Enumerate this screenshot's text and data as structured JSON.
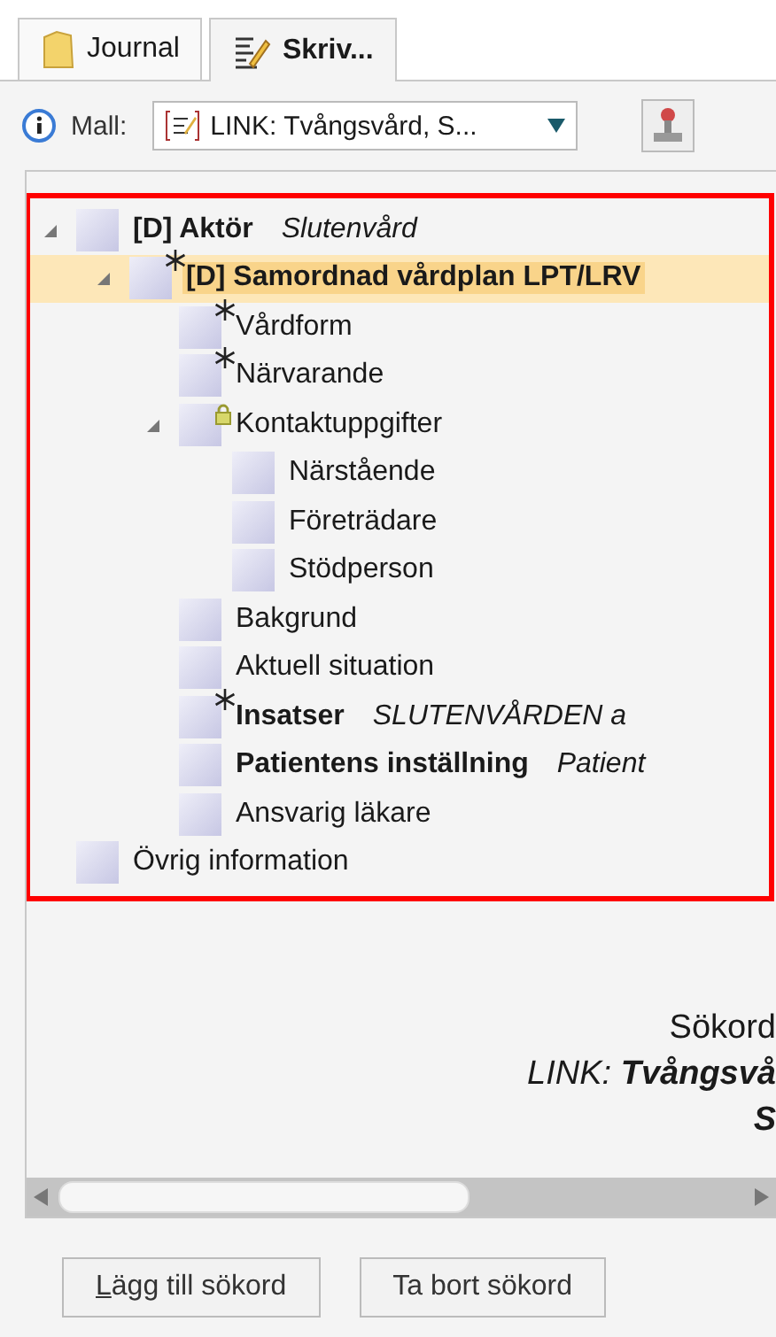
{
  "tabs": [
    {
      "label": "Journal",
      "kind": "journal",
      "selected": false
    },
    {
      "label": "Skriv...",
      "kind": "write",
      "selected": true
    }
  ],
  "toolbar": {
    "label": "Mall:",
    "template": "LINK: Tvångsvård, S..."
  },
  "tree": [
    {
      "name": "[D] Aktör",
      "detail": "Slutenvård",
      "bold": true,
      "expanded": true,
      "selected": false,
      "children": [
        {
          "name": "[D] Samordnad vårdplan LPT/LRV",
          "bold": true,
          "kind": "required",
          "expanded": true,
          "selected": true,
          "children": [
            {
              "name": "Vårdform",
              "bold": false,
              "kind": "required",
              "selected": false
            },
            {
              "name": "Närvarande",
              "bold": false,
              "kind": "required",
              "selected": false
            },
            {
              "name": "Kontaktuppgifter",
              "bold": false,
              "kind": "locked",
              "expanded": true,
              "selected": false,
              "children": [
                {
                  "name": "Närstående",
                  "bold": false,
                  "selected": false
                },
                {
                  "name": "Företrädare",
                  "bold": false,
                  "selected": false
                },
                {
                  "name": "Stödperson",
                  "bold": false,
                  "selected": false
                }
              ]
            },
            {
              "name": "Bakgrund",
              "bold": false,
              "selected": false
            },
            {
              "name": "Aktuell situation",
              "bold": false,
              "selected": false
            },
            {
              "name": "Insatser",
              "detail": "SLUTENVÅRDEN a",
              "bold": true,
              "kind": "required",
              "selected": false
            },
            {
              "name": "Patientens inställning",
              "detail": "Patient",
              "bold": true,
              "selected": false
            },
            {
              "name": "Ansvarig läkare",
              "bold": false,
              "selected": false
            }
          ]
        }
      ]
    },
    {
      "name": "Övrig information",
      "bold": false,
      "selected": false
    }
  ],
  "keyword_lines": [
    {
      "text": "Sökord",
      "italic": false
    },
    {
      "text": "LINK: **Tvångsvå**",
      "italic": true
    },
    {
      "text": "**S**",
      "italic": true
    }
  ],
  "buttons": [
    {
      "label": "Lägg till sökord",
      "mnemonic_underlined": true
    },
    {
      "label": "Ta bort sökord",
      "mnemonic_underlined": false
    }
  ]
}
